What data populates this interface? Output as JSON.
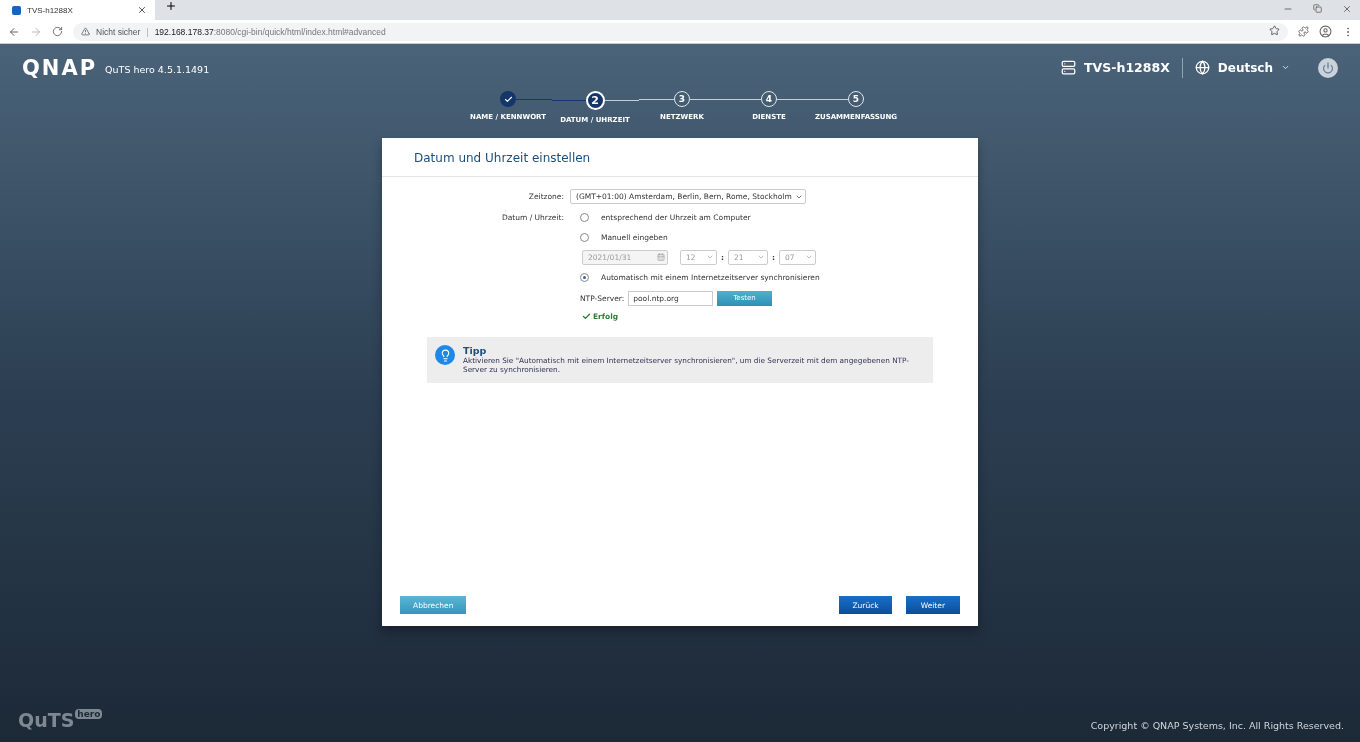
{
  "browser": {
    "tab_title": "TVS-h1288X",
    "security": "Nicht sicher",
    "separator": "|",
    "url_host": "192.168.178.37",
    "url_rest": ":8080/cgi-bin/quick/html/index.html#advanced"
  },
  "header": {
    "logo": "QNAP",
    "version": "QuTS hero 4.5.1.1491",
    "device": "TVS-h1288X",
    "language": "Deutsch"
  },
  "steps": [
    {
      "label": "NAME / KENNWORT",
      "done": true,
      "selected": false
    },
    {
      "number": "2",
      "label": "DATUM / UHRZEIT",
      "done": false,
      "selected": true
    },
    {
      "number": "3",
      "label": "NETZWERK",
      "done": false,
      "selected": false
    },
    {
      "number": "4",
      "label": "DIENSTE",
      "done": false,
      "selected": false
    },
    {
      "number": "5",
      "label": "ZUSAMMENFASSUNG",
      "done": false,
      "selected": false
    }
  ],
  "dialog": {
    "title": "Datum und Uhrzeit einstellen",
    "timezone": {
      "label": "Zeitzone:",
      "value": "(GMT+01:00) Amsterdam, Berlin, Bern, Rome, Stockholm"
    },
    "datetime_label": "Datum / Uhrzeit:",
    "options": [
      {
        "label": "entsprechend der Uhrzeit am Computer",
        "selected": false
      },
      {
        "label": "Manuell eingeben",
        "selected": false
      },
      {
        "label": "Automatisch mit einem Internetzeitserver synchronisieren",
        "selected": true
      }
    ],
    "manual": {
      "date": "2021/01/31",
      "hour": "12",
      "minute": "21",
      "second": "07",
      "separators": [
        ":",
        ":"
      ],
      "disabled": true
    },
    "ntp": {
      "label": "NTP-Server:",
      "value": "pool.ntp.org",
      "button": "Testen",
      "result": "Erfolg"
    },
    "tip": {
      "title": "Tipp",
      "text": "Aktivieren Sie \"Automatisch mit einem Internetzeitserver synchronisieren\", um die Serverzeit mit dem angegebenen NTP-Server zu synchronisieren."
    },
    "buttons": {
      "cancel": "Abbrechen",
      "back": "Zurück",
      "next": "Weiter"
    }
  },
  "footer": {
    "brand": "QuTS",
    "brand_badge": "hero",
    "copyright": "Copyright © QNAP Systems, Inc. All Rights Reserved."
  }
}
